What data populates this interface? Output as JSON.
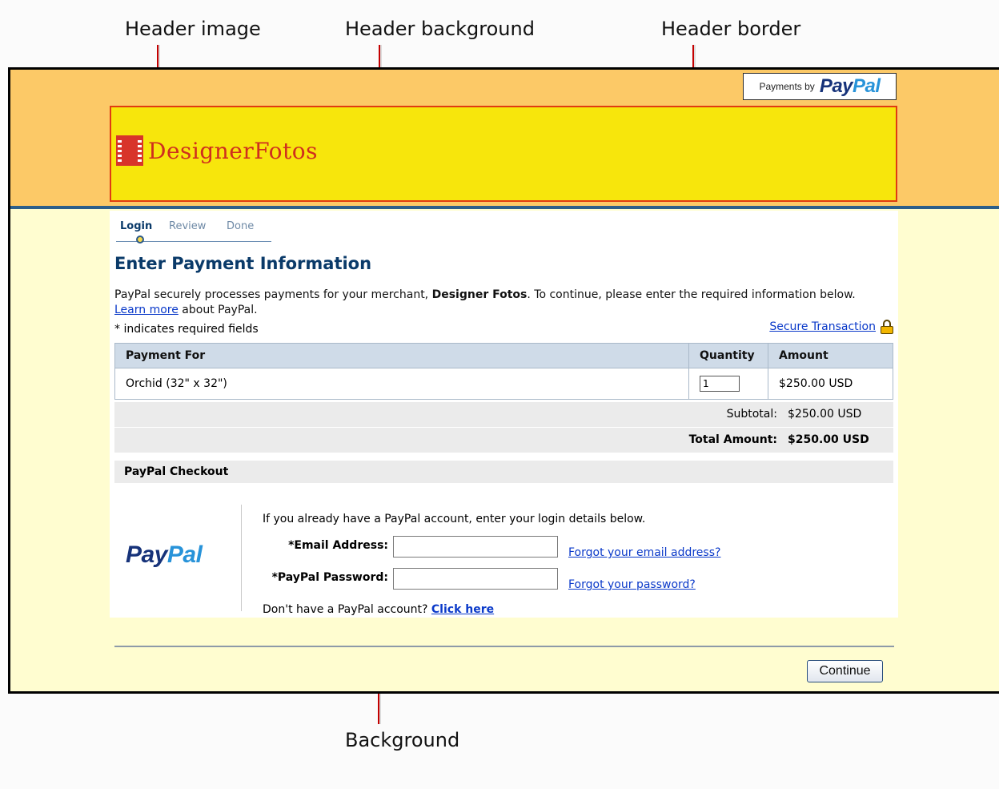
{
  "callouts": {
    "header_image": "Header image",
    "header_background": "Header background",
    "header_border": "Header border",
    "background": "Background"
  },
  "colors": {
    "header_background": "#fcc967",
    "header_area": "#f7e60c",
    "header_border": "#e03b12",
    "page_background": "#fffdd0",
    "accent": "#0a3a69",
    "link": "#0a39c9"
  },
  "paypal_badge": {
    "prefix": "Payments by",
    "logo_pay": "Pay",
    "logo_pal": "Pal"
  },
  "merchant_logo": {
    "icon": "film-strip-icon",
    "text": "DesignerFotos"
  },
  "steps": [
    {
      "label": "Login",
      "active": true
    },
    {
      "label": "Review",
      "active": false
    },
    {
      "label": "Done",
      "active": false
    }
  ],
  "title": "Enter Payment Information",
  "intro": {
    "text_before": "PayPal securely processes payments for your merchant, ",
    "merchant": "Designer Fotos",
    "text_after": ". To continue, please enter the required information below. ",
    "learn_more": "Learn more",
    "text_end": " about PayPal."
  },
  "required_note": "* indicates required fields",
  "secure_transaction": {
    "label": "Secure Transaction",
    "icon": "lock-icon"
  },
  "table": {
    "headers": [
      "Payment For",
      "Quantity",
      "Amount"
    ],
    "rows": [
      {
        "item": "Orchid (32\" x 32\")",
        "quantity": "1",
        "amount": "$250.00 USD"
      }
    ]
  },
  "subtotal": {
    "label": "Subtotal:",
    "value": "$250.00 USD"
  },
  "total": {
    "label": "Total Amount:",
    "value": "$250.00 USD"
  },
  "checkout": {
    "section_title": "PayPal Checkout",
    "logo_pay": "Pay",
    "logo_pal": "Pal",
    "intro": "If you already have a PayPal account, enter your login details below.",
    "email_label": "*Email Address:",
    "email_value": "",
    "password_label": "*PayPal Password:",
    "password_value": "",
    "forgot_email": "Forgot your email address?",
    "forgot_password": "Forgot your password?",
    "no_account": "Don't have a PayPal account?",
    "click_here": "Click here"
  },
  "continue_label": "Continue"
}
